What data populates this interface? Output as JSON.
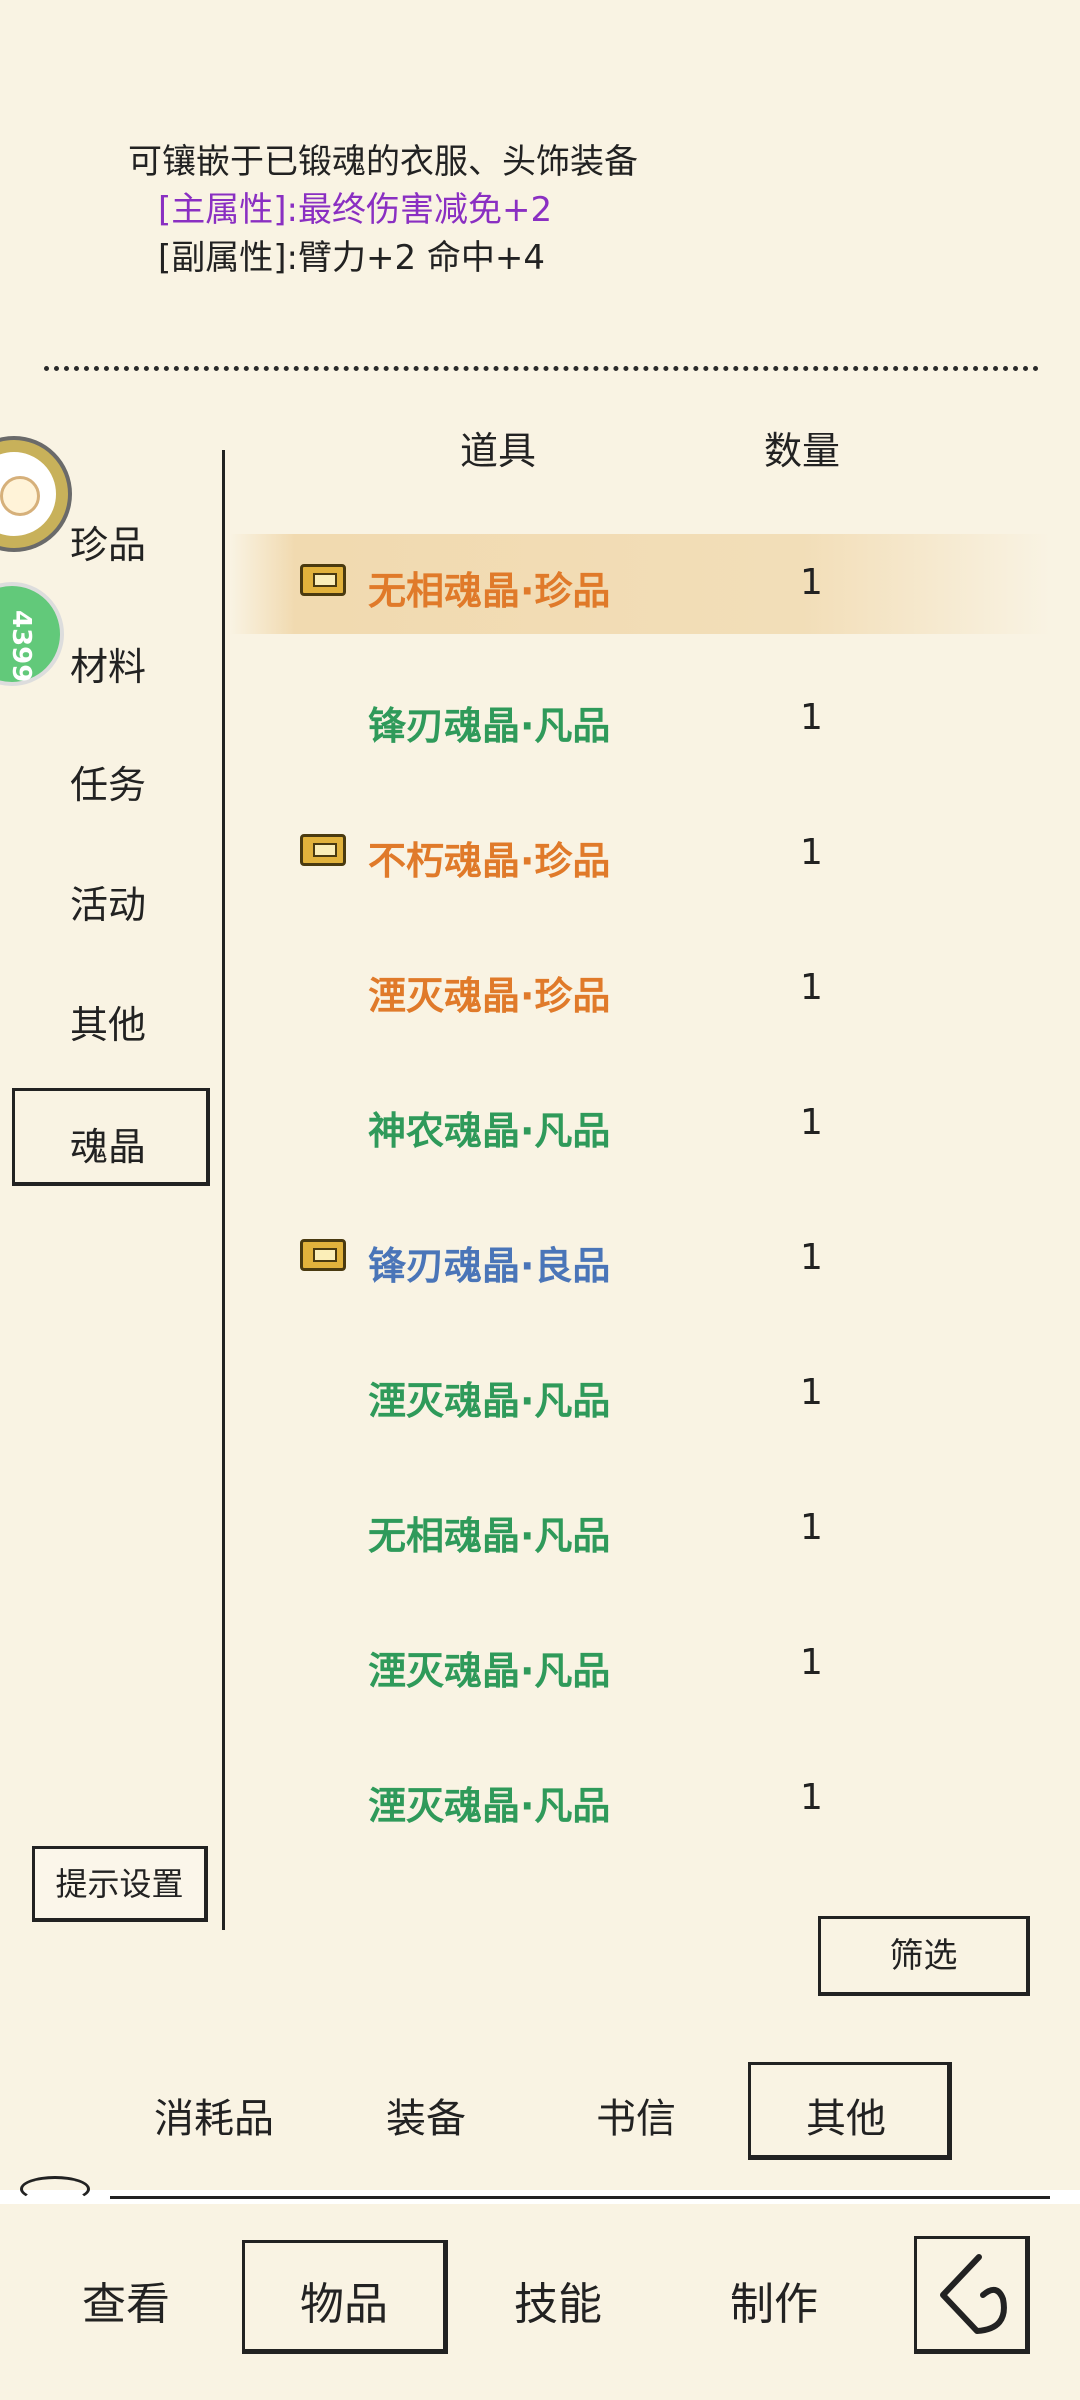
{
  "description": {
    "line1": "可镶嵌于已锻魂的衣服、头饰装备",
    "line2": "[主属性]:最终伤害减免+2",
    "line3": "[副属性]:臂力+2 命中+4"
  },
  "avatars": {
    "badge_text": "4399"
  },
  "sidebar": {
    "items": [
      {
        "label": "珍品"
      },
      {
        "label": "材料"
      },
      {
        "label": "任务"
      },
      {
        "label": "活动"
      },
      {
        "label": "其他"
      },
      {
        "label": "魂晶"
      }
    ],
    "selected": "魂晶",
    "tip_button": "提示设置"
  },
  "table": {
    "headers": {
      "item": "道具",
      "qty": "数量"
    },
    "rows": [
      {
        "name": "无相魂晶·珍品",
        "qty": "1",
        "color": "#e07a2a",
        "locked": true,
        "selected": true
      },
      {
        "name": "锋刃魂晶·凡品",
        "qty": "1",
        "color": "#2f9a5a",
        "locked": false
      },
      {
        "name": "不朽魂晶·珍品",
        "qty": "1",
        "color": "#e07a2a",
        "locked": true
      },
      {
        "name": "湮灭魂晶·珍品",
        "qty": "1",
        "color": "#e07a2a",
        "locked": false
      },
      {
        "name": "神农魂晶·凡品",
        "qty": "1",
        "color": "#2f9a5a",
        "locked": false
      },
      {
        "name": "锋刃魂晶·良品",
        "qty": "1",
        "color": "#4a75b8",
        "locked": true
      },
      {
        "name": "湮灭魂晶·凡品",
        "qty": "1",
        "color": "#2f9a5a",
        "locked": false
      },
      {
        "name": "无相魂晶·凡品",
        "qty": "1",
        "color": "#2f9a5a",
        "locked": false
      },
      {
        "name": "湮灭魂晶·凡品",
        "qty": "1",
        "color": "#2f9a5a",
        "locked": false
      },
      {
        "name": "湮灭魂晶·凡品",
        "qty": "1",
        "color": "#2f9a5a",
        "locked": false
      }
    ]
  },
  "filter_button": "筛选",
  "sub_tabs": [
    {
      "label": "消耗品"
    },
    {
      "label": "装备"
    },
    {
      "label": "书信"
    },
    {
      "label": "其他"
    }
  ],
  "sub_tab_selected": "其他",
  "bottom_nav": [
    {
      "label": "查看"
    },
    {
      "label": "物品"
    },
    {
      "label": "技能"
    },
    {
      "label": "制作"
    }
  ],
  "bottom_nav_selected": "物品",
  "back_icon": "back-arrow-icon"
}
